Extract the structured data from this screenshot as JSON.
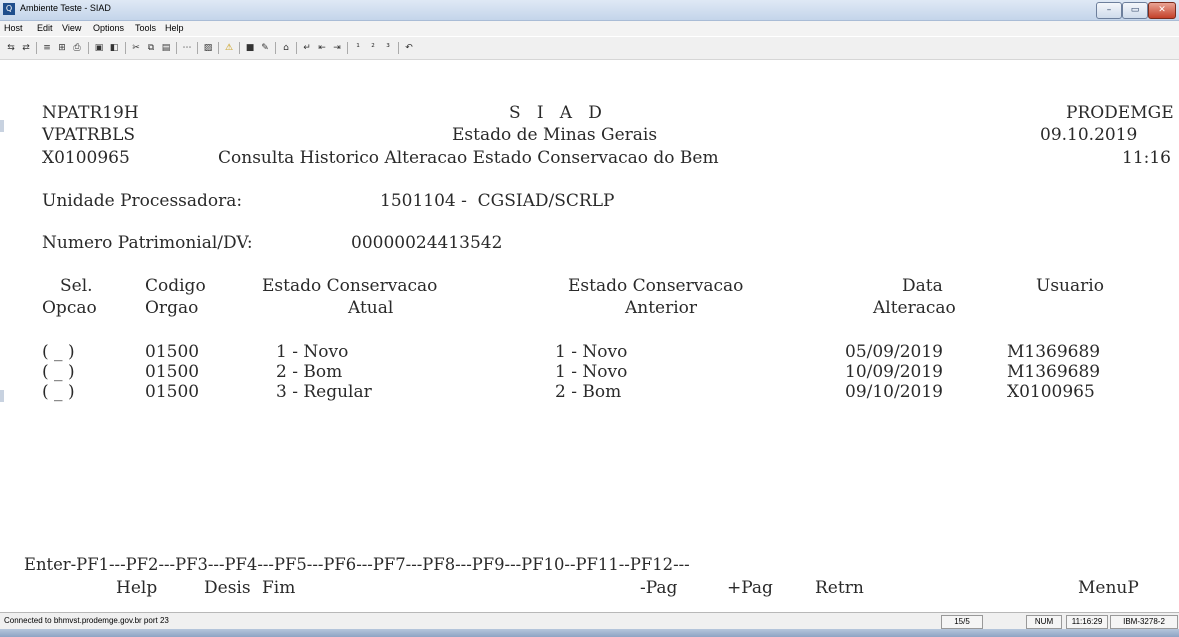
{
  "window": {
    "title": "Ambiente Teste - SIAD",
    "app_icon_label": "Q",
    "minimize_glyph": "–",
    "maximize_glyph": "▭",
    "close_glyph": "✕"
  },
  "menu": {
    "items": [
      "Host",
      "Edit",
      "View",
      "Options",
      "Tools",
      "Help"
    ]
  },
  "toolbar": {
    "icons": [
      {
        "name": "connect-icon",
        "glyph": "⇆"
      },
      {
        "name": "disconnect-icon",
        "glyph": "⇄"
      },
      {
        "name": "send-icon",
        "glyph": "≡"
      },
      {
        "name": "receive-icon",
        "glyph": "⊞"
      },
      {
        "name": "print-icon",
        "glyph": "⎙"
      },
      {
        "name": "page-setup-icon",
        "glyph": "▣"
      },
      {
        "name": "save-session-icon",
        "glyph": "◧"
      },
      {
        "name": "cut-icon",
        "glyph": "✂"
      },
      {
        "name": "copy-icon",
        "glyph": "⧉"
      },
      {
        "name": "paste-icon",
        "glyph": "▤"
      },
      {
        "name": "more-icon",
        "glyph": "⋯"
      },
      {
        "name": "chart-icon",
        "glyph": "▨"
      },
      {
        "name": "warning-icon",
        "glyph": "⚠"
      },
      {
        "name": "screen-icon",
        "glyph": "■"
      },
      {
        "name": "macro-icon",
        "glyph": "✎"
      },
      {
        "name": "home-icon",
        "glyph": "⌂"
      },
      {
        "name": "enter-icon",
        "glyph": "↵"
      },
      {
        "name": "backtab-icon",
        "glyph": "⇤"
      },
      {
        "name": "tab-icon",
        "glyph": "⇥"
      },
      {
        "name": "pf1-icon",
        "glyph": "¹"
      },
      {
        "name": "pf2-icon",
        "glyph": "²"
      },
      {
        "name": "pf3-icon",
        "glyph": "³"
      },
      {
        "name": "undo-icon",
        "glyph": "↶"
      }
    ]
  },
  "terminal": {
    "header": {
      "program": "NPATR19H",
      "system": "S   I   A   D",
      "company": "PRODEMGE",
      "screen_id": "VPATRBLS",
      "state": "Estado de Minas Gerais",
      "date": "09.10.2019",
      "user": "X0100965",
      "screen_title": "Consulta Historico Alteracao Estado Conservacao do Bem",
      "time": "11:16"
    },
    "unidade_label": "Unidade Processadora:",
    "unidade_value": "1501104 -  CGSIAD/SCRLP",
    "patrimonio_label": "Numero Patrimonial/DV:",
    "patrimonio_value": "00000024413542",
    "columns_row1": {
      "sel": "Sel.",
      "codigo": "Codigo",
      "estado_atual": "Estado Conservacao",
      "estado_anterior": "Estado Conservacao",
      "data": "Data",
      "usuario": "Usuario"
    },
    "columns_row2": {
      "opcao": "Opcao",
      "orgao": "Orgao",
      "atual": "Atual",
      "anterior": "Anterior",
      "alteracao": "Alteracao"
    },
    "rows": [
      {
        "sel": "( _ )",
        "orgao": "01500",
        "atual": "1 - Novo",
        "anterior": "1 - Novo",
        "data": "05/09/2019",
        "usuario": "M1369689"
      },
      {
        "sel": "( _ )",
        "orgao": "01500",
        "atual": "2 - Bom",
        "anterior": "1 - Novo",
        "data": "10/09/2019",
        "usuario": "M1369689"
      },
      {
        "sel": "( _ )",
        "orgao": "01500",
        "atual": "3 - Regular",
        "anterior": "2 - Bom",
        "data": "09/10/2019",
        "usuario": "X0100965"
      }
    ],
    "pf_line": "Enter-PF1---PF2---PF3---PF4---PF5---PF6---PF7---PF8---PF9---PF10--PF11--PF12---",
    "pf_keys": {
      "help": "Help",
      "desis": "Desis",
      "fim": "Fim",
      "pag_minus": "-Pag",
      "pag_plus": "+Pag",
      "retrn": "Retrn",
      "menup": "MenuP"
    }
  },
  "status": {
    "connection": "Connected to bhmvst.prodemge.gov.br port 23",
    "cursor": "15/5",
    "num": "NUM",
    "clock": "11:16:29",
    "terminal_type": "IBM-3278-2"
  }
}
